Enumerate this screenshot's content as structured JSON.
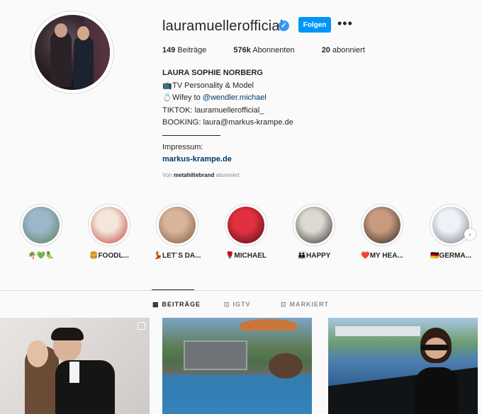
{
  "profile": {
    "username": "lauramuellerofficial",
    "follow_label": "Folgen",
    "more_label": "•••",
    "verified_mark": "✓"
  },
  "stats": {
    "posts_count": "149",
    "posts_label": "Beiträge",
    "followers_count": "576k",
    "followers_label": "Abonnenten",
    "following_count": "20",
    "following_label": "abonniert"
  },
  "bio": {
    "name": "LAURA SOPHIE NORBERG",
    "line1_icon": "📺",
    "line1": "TV Personality & Model",
    "line2_icon": "💍",
    "line2_prefix": "Wifey to ",
    "line2_mention": "@wendler.michael",
    "line3": "TIKTOK: lauramuellerofficial_",
    "line4": "BOOKING: laura@markus-krampe.de",
    "line5": "Impressum:",
    "website": "markus-krampe.de",
    "followed_by_prefix": "Von ",
    "followed_by_user": "metahiltebrand",
    "followed_by_suffix": " abonniert"
  },
  "highlights": [
    {
      "label": "🌴💚🦜",
      "colors": [
        "#9bb7c9",
        "#5c7a5a"
      ]
    },
    {
      "label": "🍔FOODL...",
      "colors": [
        "#f2e7da",
        "#c23b3b"
      ]
    },
    {
      "label": "💃LET´S DA...",
      "colors": [
        "#d8b49a",
        "#7a5640"
      ]
    },
    {
      "label": "🌹MICHAEL",
      "colors": [
        "#e23040",
        "#4a0d14"
      ]
    },
    {
      "label": "👪HAPPY",
      "colors": [
        "#dcd8d2",
        "#2c2a2a"
      ]
    },
    {
      "label": "❤️MY HEA...",
      "colors": [
        "#c89a7e",
        "#2a2422"
      ]
    },
    {
      "label": "🇩🇪GERMA...",
      "colors": [
        "#eef1f5",
        "#6c7a8c"
      ]
    }
  ],
  "highlights_next_label": "›",
  "tabs": [
    {
      "label": "BEITRÄGE",
      "icon": "▦"
    },
    {
      "label": "IGTV",
      "icon": "⊡"
    },
    {
      "label": "MARKIERT",
      "icon": "⊡"
    }
  ],
  "colors": {
    "accent": "#0095f6",
    "verified": "#3897f0",
    "link": "#00376b"
  }
}
